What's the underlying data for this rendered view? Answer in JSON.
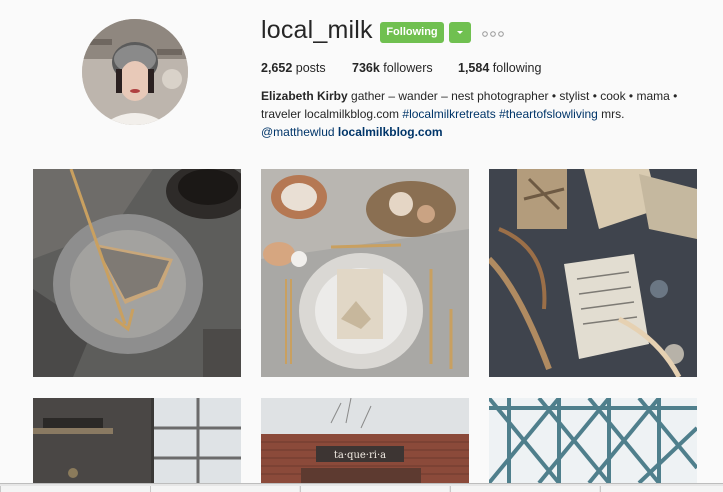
{
  "profile": {
    "username": "local_milk",
    "follow_label": "Following",
    "stats": {
      "posts_count": "2,652",
      "posts_label": "posts",
      "followers_count": "736k",
      "followers_label": "followers",
      "following_count": "1,584",
      "following_label": "following"
    },
    "bio": {
      "name": "Elizabeth Kirby",
      "text1": " gather – wander – nest photographer • stylist • cook • mama • traveler localmilkblog.com ",
      "tag1": "#localmilkretreats",
      "tag2": "#theartofslowliving",
      "text2": " mrs. ",
      "mention": "@matthewlud",
      "link": "localmilkblog.com"
    }
  },
  "photos": [
    {
      "name": "photo-tart-and-coffee"
    },
    {
      "name": "photo-table-setting"
    },
    {
      "name": "photo-letters-and-ribbons"
    },
    {
      "name": "photo-interior-window"
    },
    {
      "name": "photo-taqueria-storefront",
      "sign_text": "ta·que·ri·a"
    },
    {
      "name": "photo-steel-structure"
    }
  ],
  "colors": {
    "follow_green": "#70c050",
    "link_blue": "#003569"
  }
}
